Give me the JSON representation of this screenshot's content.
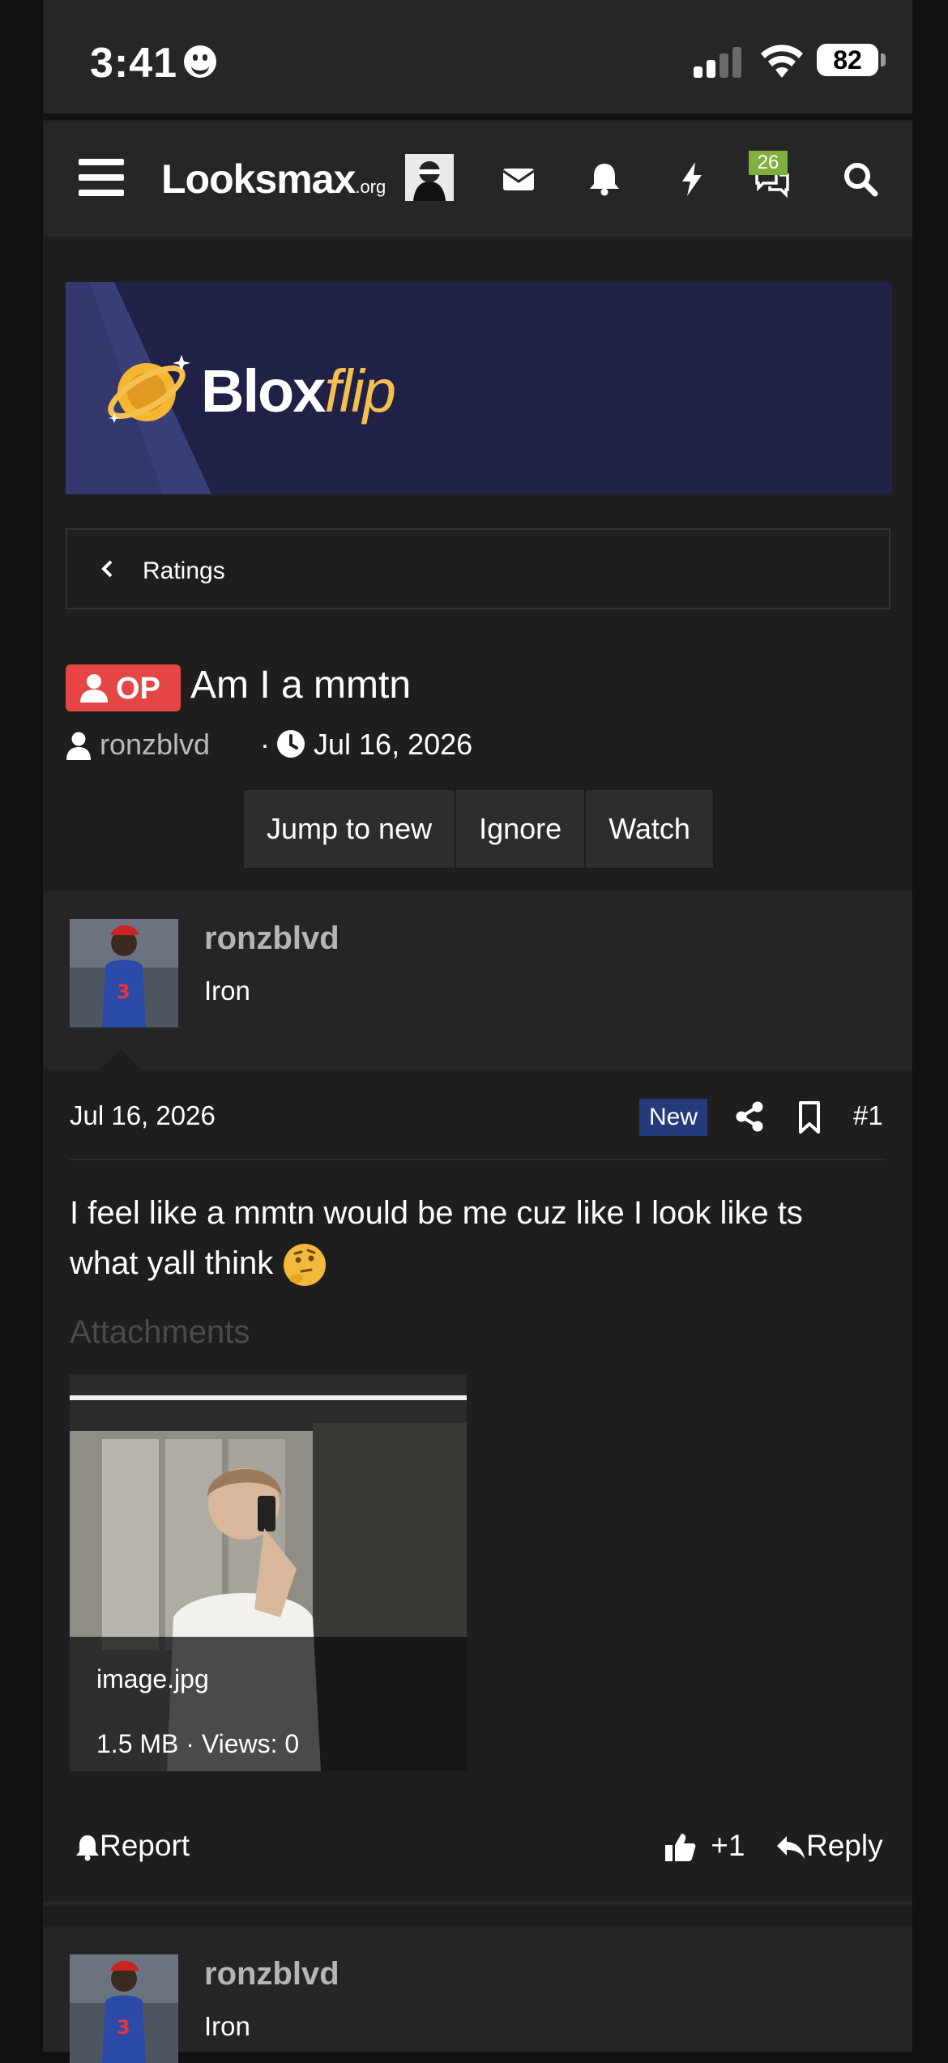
{
  "status_bar": {
    "time": "3:41",
    "battery": "82"
  },
  "header": {
    "logo_main": "Looksmax",
    "logo_suffix": ".org",
    "chat_badge": "26"
  },
  "banner": {
    "brand_part1": "Blox",
    "brand_part2": "flip"
  },
  "breadcrumb": {
    "label": "Ratings"
  },
  "thread": {
    "op_label": "OP",
    "title": "Am I a mmtn",
    "author": "ronzblvd",
    "separator": "·",
    "date": "Jul 16, 2026",
    "buttons": {
      "jump": "Jump to new",
      "ignore": "Ignore",
      "watch": "Watch"
    }
  },
  "posts": [
    {
      "username": "ronzblvd",
      "rank": "Iron",
      "date": "Jul 16, 2026",
      "badge": "New",
      "number": "#1",
      "text": "I feel like a mmtn would be me cuz like I look like ts what yall think",
      "attachments_label": "Attachments",
      "attachment": {
        "filename": "image.jpg",
        "meta": "1.5 MB · Views: 0"
      },
      "actions": {
        "report": "Report",
        "reaction_count": "+1",
        "reply": "Reply"
      }
    },
    {
      "username": "ronzblvd",
      "rank": "Iron"
    }
  ],
  "colors": {
    "op_badge": "#e54545",
    "new_badge": "#243a7a",
    "chat_badge": "#7fb03c",
    "banner_bg": "#22234a",
    "banner_accent": "#f5c04f"
  }
}
